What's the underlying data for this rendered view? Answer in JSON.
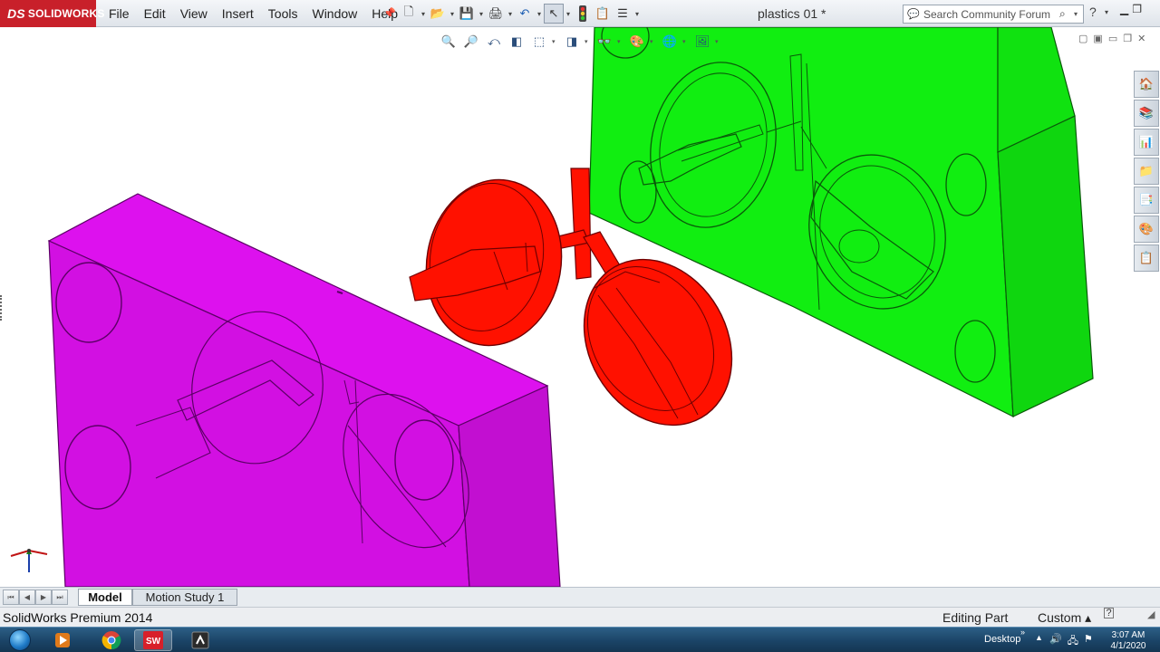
{
  "app": {
    "brand": "SOLIDWORKS",
    "document_title": "plastics 01 *"
  },
  "menu": {
    "items": [
      "File",
      "Edit",
      "View",
      "Insert",
      "Tools",
      "Window",
      "Help"
    ]
  },
  "toolbar": {
    "buttons": [
      "new-icon",
      "open-icon",
      "save-icon",
      "print-icon",
      "undo-icon",
      "select-icon",
      "rebuild-icon",
      "file-properties-icon",
      "options-icon"
    ]
  },
  "search": {
    "placeholder": "Search Community Forum"
  },
  "headsup": {
    "buttons": [
      "zoom-to-fit-icon",
      "zoom-to-area-icon",
      "previous-view-icon",
      "section-view-icon",
      "view-orientation-icon",
      "display-style-icon",
      "hide-show-items-icon",
      "edit-appearance-icon",
      "apply-scene-icon",
      "view-settings-icon"
    ]
  },
  "taskpane": {
    "buttons": [
      "solidworks-resources-icon",
      "design-library-icon",
      "file-explorer-icon",
      "view-palette-icon",
      "appearances-icon",
      "custom-properties-icon",
      "forum-icon"
    ]
  },
  "tabs": {
    "model": "Model",
    "motion_study": "Motion Study 1"
  },
  "status": {
    "product": "SolidWorks Premium 2014",
    "mode": "Editing Part",
    "units": "Custom",
    "units_arrow": "▴"
  },
  "taskbar": {
    "desktop_label": "Desktop",
    "time": "3:07 AM",
    "date": "4/1/2020",
    "apps": [
      "media-player-icon",
      "chrome-icon",
      "solidworks-icon",
      "screen-recorder-icon"
    ]
  },
  "scene": {
    "colors": {
      "cavity_plate": "#dd11ee",
      "core_plate": "#11ee11",
      "molded_part": "#ff1100"
    }
  }
}
